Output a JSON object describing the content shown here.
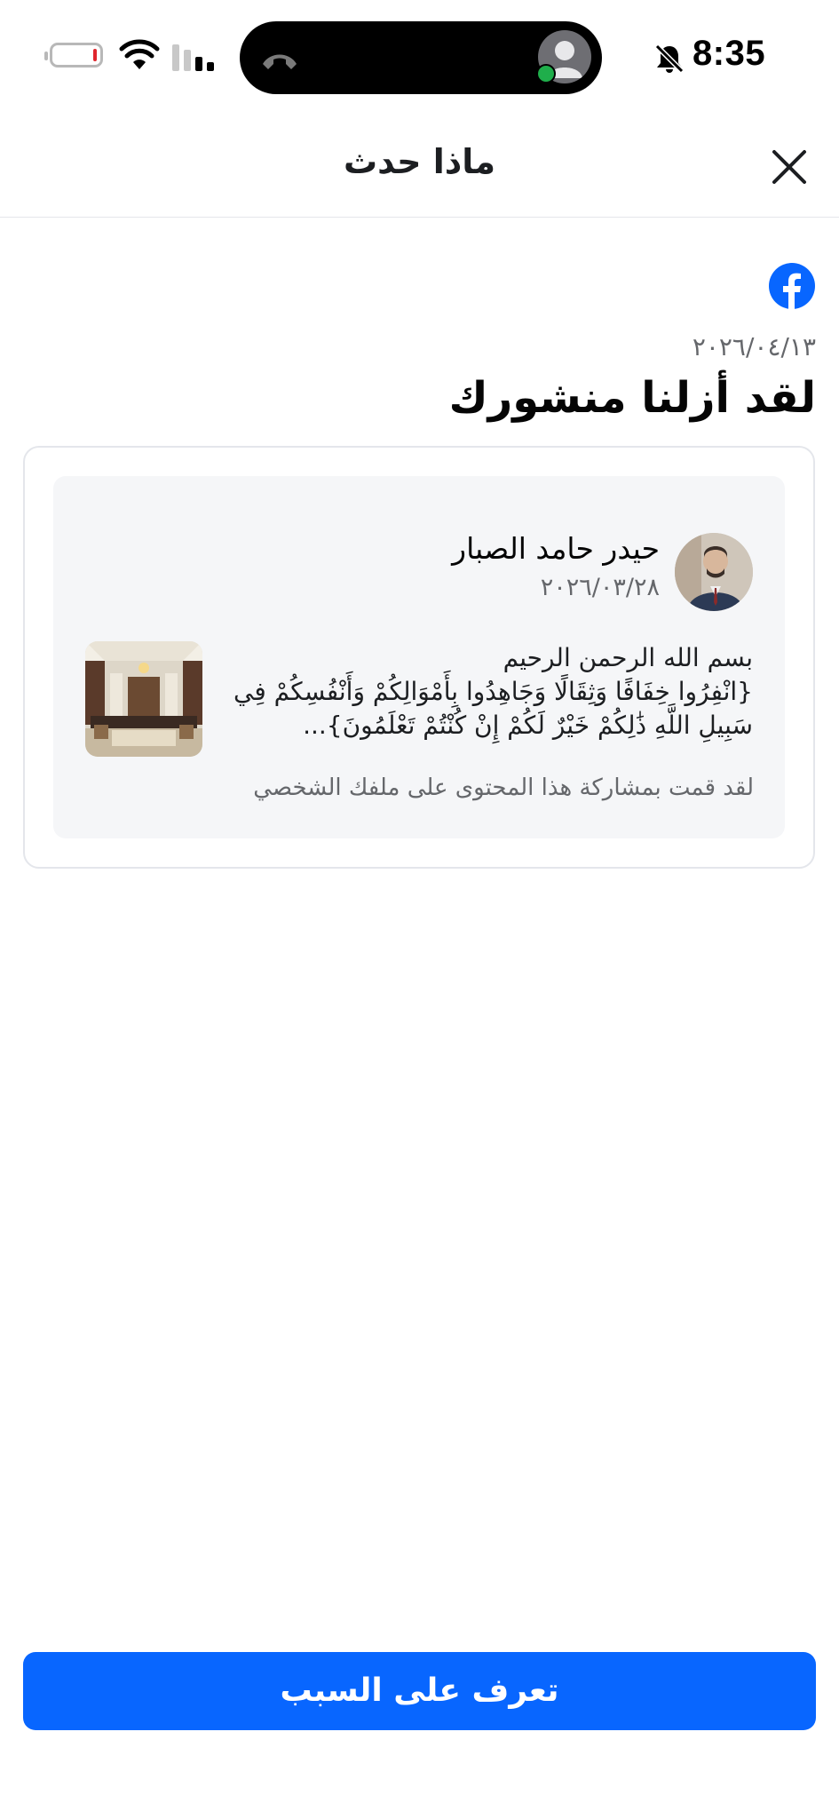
{
  "status_bar": {
    "time": "8:35"
  },
  "header": {
    "title": "ماذا حدث"
  },
  "notice": {
    "date": "٢٠٢٦/٠٤/١٣",
    "title": "لقد أزلنا منشورك"
  },
  "post": {
    "author": "حيدر حامد الصبار",
    "date": "٢٠٢٦/٠٣/٢٨",
    "text": "بسم الله الرحمن الرحيم\n{انْفِرُوا خِفَافًا وَثِقَالًا وَجَاهِدُوا بِأَمْوَالِكُمْ وَأَنْفُسِكُمْ فِي سَبِيلِ اللَّهِ ذَٰلِكُمْ خَيْرٌ لَكُمْ إِنْ كُنْتُمْ تَعْلَمُونَ}...",
    "shared_note": "لقد قمت بمشاركة هذا المحتوى على ملفك الشخصي"
  },
  "footer": {
    "learn_button": "تعرف على السبب"
  },
  "colors": {
    "primary": "#0866ff",
    "battery_low": "#e0262d"
  }
}
